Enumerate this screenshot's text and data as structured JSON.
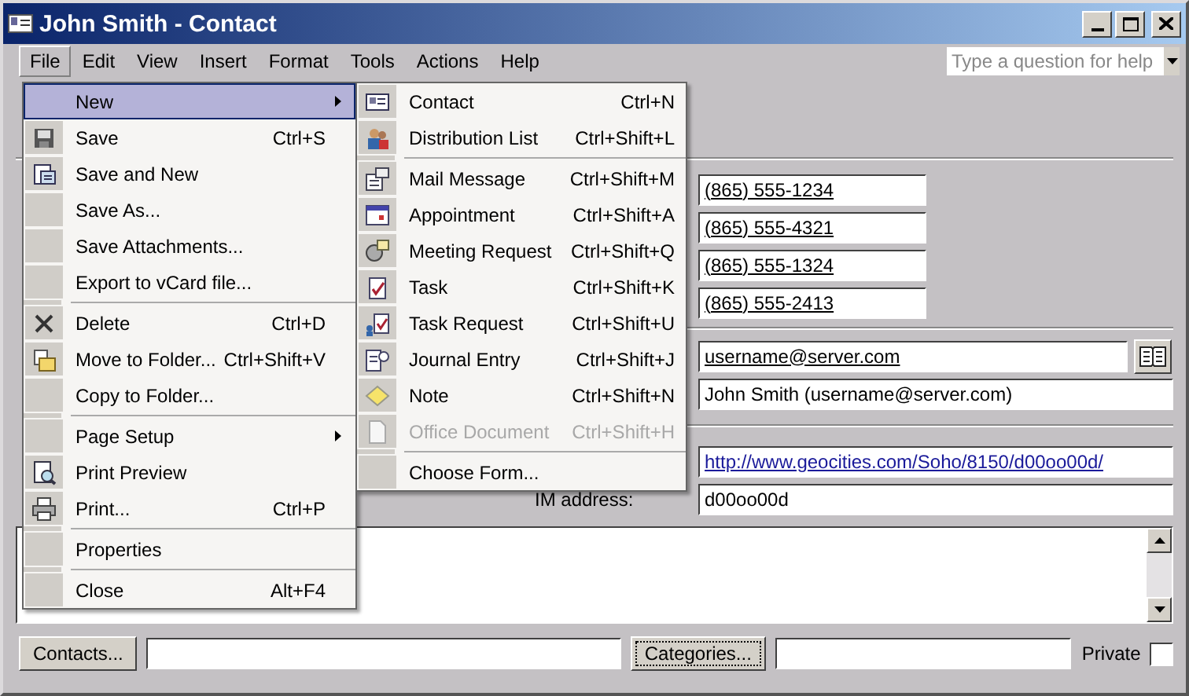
{
  "window": {
    "title": "John Smith - Contact"
  },
  "menu_bar": [
    {
      "label": "File",
      "selected": true
    },
    {
      "label": "Edit",
      "selected": false
    },
    {
      "label": "View",
      "selected": false
    },
    {
      "label": "Insert",
      "selected": false
    },
    {
      "label": "Format",
      "selected": false
    },
    {
      "label": "Tools",
      "selected": false
    },
    {
      "label": "Actions",
      "selected": false
    },
    {
      "label": "Help",
      "selected": false
    }
  ],
  "help_box": {
    "placeholder": "Type a question for help"
  },
  "file_menu": [
    {
      "kind": "item",
      "label": "New",
      "submenu": true,
      "selected": true
    },
    {
      "kind": "item",
      "label": "Save",
      "shortcut": "Ctrl+S",
      "submenu": false,
      "selected": false
    },
    {
      "kind": "item",
      "label": "Save and New",
      "submenu": false,
      "selected": false
    },
    {
      "kind": "item",
      "label": "Save As...",
      "submenu": false,
      "selected": false
    },
    {
      "kind": "item",
      "label": "Save Attachments...",
      "submenu": false,
      "selected": false
    },
    {
      "kind": "item",
      "label": "Export to vCard file...",
      "submenu": false,
      "selected": false
    },
    {
      "kind": "separator"
    },
    {
      "kind": "item",
      "label": "Delete",
      "shortcut": "Ctrl+D",
      "submenu": false,
      "selected": false
    },
    {
      "kind": "item",
      "label": "Move to Folder...",
      "shortcut": "Ctrl+Shift+V",
      "submenu": false,
      "selected": false
    },
    {
      "kind": "item",
      "label": "Copy to Folder...",
      "submenu": false,
      "selected": false
    },
    {
      "kind": "separator"
    },
    {
      "kind": "item",
      "label": "Page Setup",
      "submenu": true,
      "selected": false
    },
    {
      "kind": "item",
      "label": "Print Preview",
      "submenu": false,
      "selected": false
    },
    {
      "kind": "item",
      "label": "Print...",
      "shortcut": "Ctrl+P",
      "submenu": false,
      "selected": false
    },
    {
      "kind": "separator"
    },
    {
      "kind": "item",
      "label": "Properties",
      "submenu": false,
      "selected": false
    },
    {
      "kind": "separator"
    },
    {
      "kind": "item",
      "label": "Close",
      "shortcut": "Alt+F4",
      "submenu": false,
      "selected": false
    }
  ],
  "new_submenu": [
    {
      "kind": "item",
      "label": "Contact",
      "shortcut": "Ctrl+N",
      "disabled": false
    },
    {
      "kind": "item",
      "label": "Distribution List",
      "shortcut": "Ctrl+Shift+L",
      "disabled": false
    },
    {
      "kind": "separator"
    },
    {
      "kind": "item",
      "label": "Mail Message",
      "shortcut": "Ctrl+Shift+M",
      "disabled": false
    },
    {
      "kind": "item",
      "label": "Appointment",
      "shortcut": "Ctrl+Shift+A",
      "disabled": false
    },
    {
      "kind": "item",
      "label": "Meeting Request",
      "shortcut": "Ctrl+Shift+Q",
      "disabled": false
    },
    {
      "kind": "item",
      "label": "Task",
      "shortcut": "Ctrl+Shift+K",
      "disabled": false
    },
    {
      "kind": "item",
      "label": "Task Request",
      "shortcut": "Ctrl+Shift+U",
      "disabled": false
    },
    {
      "kind": "item",
      "label": "Journal Entry",
      "shortcut": "Ctrl+Shift+J",
      "disabled": false
    },
    {
      "kind": "item",
      "label": "Note",
      "shortcut": "Ctrl+Shift+N",
      "disabled": false
    },
    {
      "kind": "item",
      "label": "Office Document",
      "shortcut": "Ctrl+Shift+H",
      "disabled": true
    },
    {
      "kind": "separator"
    },
    {
      "kind": "item",
      "label": "Choose Form...",
      "disabled": false
    }
  ],
  "form": {
    "phones": [
      "(865) 555-1234",
      "(865) 555-4321",
      "(865) 555-1324",
      "(865) 555-2413"
    ],
    "email": "username@server.com",
    "display_as": "John Smith (username@server.com)",
    "web_page": "http://www.geocities.com/Soho/8150/d00oo00d/",
    "im_label": "IM address:",
    "im_address": "d00oo00d"
  },
  "bottom_bar": {
    "contacts_button": "Contacts...",
    "categories_button": "Categories...",
    "private_label": "Private",
    "private_checked": false
  }
}
